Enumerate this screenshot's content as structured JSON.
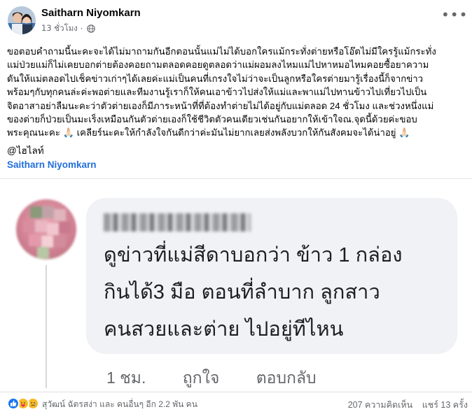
{
  "post": {
    "author": "Saitharn Niyomkarn",
    "time": "13 ชั่วโมง",
    "audience_icon": "globe-icon",
    "more_icon": "more-options-icon",
    "body_lines": [
      "ขอตอบคำถามนี้นะคะจะได้ไม่มาถามกันอีกตอนนั้นแม่ไม่ได้บอกใครแม้กระทั่งต่ายหรือโอ๊ตไม่มีใครรู้แม้กระทั่ง",
      "แม่ป่วยแม่ก็ไม่เคยบอกต่ายต้องคอยถามตลอดคอยดูตลอดว่าแม่ผอมลงไหมแม่ไปหาหมอไหมคอยซื้อยาความ",
      "ดันให้แม่ตลอดไปเช็คข่าวเก่าๆได้เลยค่ะแม่เป็นคนที่เกรงใจไม่ว่าจะเป็นลูกหรือใครต่ายมารู้เรื่องนี้ก็จากข่าว",
      "พร้อมๆกับทุกคนล่ะค่ะพอต่ายและทีมงานรู้เราก็ให้คนเอาข้าวไปส่งให้แม่และพาแม่ไปทานข้าวไปเที่ยวไปเป็น",
      "จิตอาสาอย่าลืมนะคะว่าตัวต่ายเองก็มีภาระหน้าที่ที่ต้องทำต่ายไม่ได้อยู่กับแม่ตลอด 24 ชั่วโมง และช่วงหนึ่งแม่",
      "ของต่ายก็ป่วยเป็นมะเร็งเหมือนกันตัวต่ายเองก็ใช้ชีวิตตัวคนเดียวเช่นกันอยากให้เข้าใจณ.จุดนี้ด้วยค่ะขอบ",
      "พระคุณนะคะ 🙏🏻 เคลียร์นะคะให้กำลังใจกันดีกว่าค่ะมันไม่ยากเลยส่งพลังบวกให้กันสังคมจะได้น่าอยู่ 🙏🏻"
    ],
    "credit_tag": "@ไฮไลท์",
    "credit_link": "Saitharn Niyomkarn"
  },
  "embedded_comment": {
    "text_lines": [
      "ดูข่าวที่แม่สีดาบอกว่า ข้าว 1 กล่อง",
      "กินได้3 มือ ตอนที่ลำบาก ลูกสาว",
      "คนสวยและต่าย ไปอยู่ทีไหน"
    ],
    "time": "1 ชม.",
    "like_label": "ถูกใจ",
    "reply_label": "ตอบกลับ"
  },
  "footer": {
    "reaction_icons": [
      "like-reaction-icon",
      "care-reaction-icon",
      "sad-reaction-icon"
    ],
    "reactors": "สุวัฒน์ ฉัตรสง่า และ คนอื่นๆ อีก 2.2 พัน คน",
    "comments": "207 ความคิดเห็น",
    "shares": "แชร์ 13 ครั้ง",
    "colors": {
      "like": "#1877f2",
      "care": "#f7b928",
      "link": "#216fdb"
    }
  }
}
